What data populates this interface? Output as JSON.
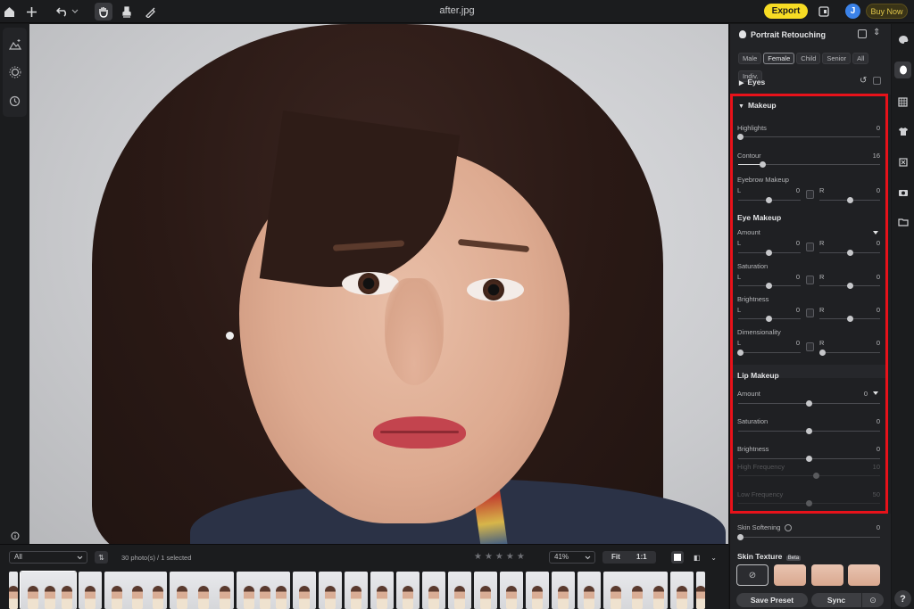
{
  "topbar": {
    "title": "after.jpg",
    "export_label": "Export",
    "avatar_letter": "J",
    "buy_now_label": "Buy Now"
  },
  "panel": {
    "title": "Portrait Retouching",
    "chips": [
      "Male",
      "Female",
      "Child",
      "Senior",
      "All",
      "Indiv."
    ],
    "active_chip": "Female",
    "eyes_label": "Eyes",
    "makeup": {
      "title": "Makeup",
      "highlights": {
        "label": "Highlights",
        "value": "0",
        "level": 0
      },
      "contour": {
        "label": "Contour",
        "value": "16",
        "level": 0.16
      },
      "eyebrow": {
        "label": "Eyebrow Makeup",
        "left_label": "L",
        "left_value": "0",
        "right_label": "R",
        "right_value": "0"
      },
      "eye_makeup": {
        "title": "Eye Makeup",
        "rows": [
          {
            "label": "Amount",
            "left_value": "0",
            "right_value": "0"
          },
          {
            "label": "Saturation",
            "left_value": "0",
            "right_value": "0"
          },
          {
            "label": "Brightness",
            "left_value": "0",
            "right_value": "0"
          },
          {
            "label": "Dimensionality",
            "left_value": "0",
            "right_value": "0"
          }
        ]
      },
      "lip_makeup": {
        "title": "Lip Makeup",
        "amount": {
          "label": "Amount",
          "value": "0"
        },
        "saturation": {
          "label": "Saturation",
          "value": "0"
        },
        "brightness": {
          "label": "Brightness",
          "value": "0"
        },
        "high_frequency": {
          "label": "High Frequency",
          "value": "10"
        },
        "low_frequency": {
          "label": "Low Frequency",
          "value": "50"
        }
      }
    },
    "skin_softening": {
      "label": "Skin Softening",
      "value": "0"
    },
    "skin_texture": {
      "label": "Skin Texture",
      "badge": "Beta"
    },
    "save_preset_label": "Save Preset",
    "sync_label": "Sync"
  },
  "filmstrip": {
    "filter_value": "All",
    "count_text": "30 photo(s) / 1 selected",
    "zoom_value": "41%",
    "fit_label": "Fit",
    "one_to_one_label": "1:1"
  },
  "icons": {
    "top": [
      "home-icon",
      "plus-icon",
      "undo-icon",
      "hand-icon",
      "stamp-icon",
      "brush-icon"
    ],
    "left": [
      "landscape-ai-icon",
      "burst-icon",
      "history-icon"
    ],
    "right": [
      "palette-icon",
      "portrait-icon",
      "grid-icon",
      "shirt-icon",
      "crop-icon",
      "camera-icon",
      "folder-icon",
      "help-icon"
    ]
  },
  "colors": {
    "accent_yellow": "#f7dc24",
    "highlight_red": "#e8121a",
    "avatar_blue": "#3b82e8"
  }
}
